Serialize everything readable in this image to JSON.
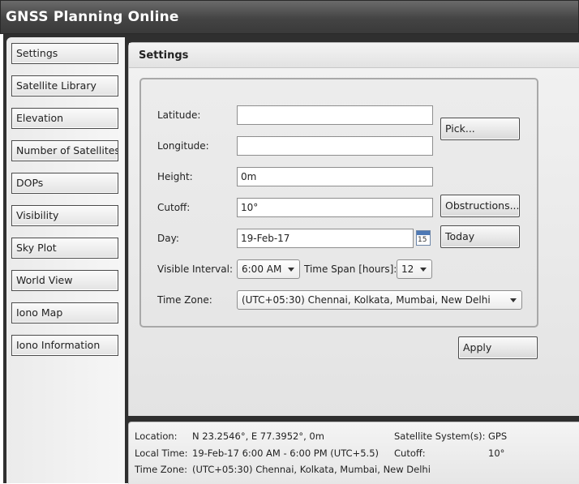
{
  "app": {
    "title": "GNSS Planning Online"
  },
  "nav": {
    "items": [
      "Settings",
      "Satellite Library",
      "Elevation",
      "Number of Satellites",
      "DOPs",
      "Visibility",
      "Sky Plot",
      "World View",
      "Iono Map",
      "Iono Information"
    ]
  },
  "settings": {
    "header": "Settings",
    "latitude": {
      "label": "Latitude:",
      "value": ""
    },
    "longitude": {
      "label": "Longitude:",
      "value": ""
    },
    "pick_button": "Pick...",
    "height": {
      "label": "Height:",
      "value": "0m"
    },
    "cutoff": {
      "label": "Cutoff:",
      "value": "10°"
    },
    "obstructions_button": "Obstructions...",
    "day": {
      "label": "Day:",
      "value": "19-Feb-17",
      "calendar_day": "15"
    },
    "today_button": "Today",
    "visible_interval": {
      "label": "Visible Interval:",
      "value": "6:00 AM"
    },
    "time_span": {
      "label": "Time Span [hours]:",
      "value": "12"
    },
    "time_zone": {
      "label": "Time Zone:",
      "value": "(UTC+05:30) Chennai, Kolkata, Mumbai, New Delhi"
    },
    "apply_button": "Apply"
  },
  "status": {
    "location_label": "Location:",
    "location_value": "N 23.2546°, E 77.3952°, 0m",
    "local_time_label": "Local Time:",
    "local_time_value": "19-Feb-17 6:00 AM - 6:00 PM (UTC+5.5)",
    "time_zone_label": "Time Zone:",
    "time_zone_value": "(UTC+05:30) Chennai, Kolkata, Mumbai, New Delhi",
    "satellite_system_label": "Satellite System(s):",
    "satellite_system_value": "GPS",
    "cutoff_label": "Cutoff:",
    "cutoff_value": "10°"
  }
}
